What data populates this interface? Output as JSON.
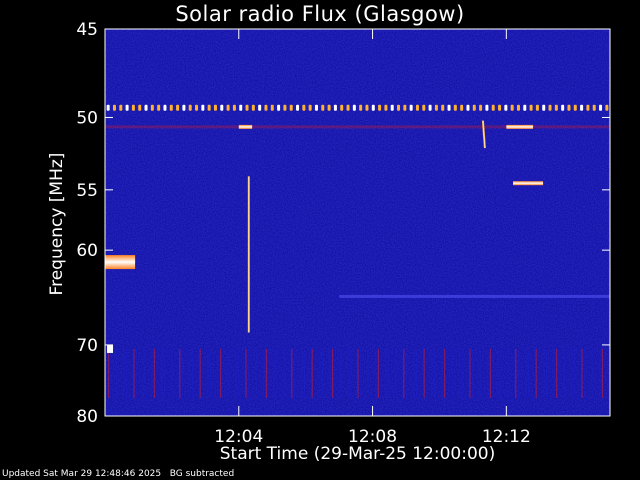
{
  "chart_data": {
    "type": "heatmap",
    "title": "Solar radio Flux (Glasgow)",
    "xlabel": "Start Time (29-Mar-25 12:00:00)",
    "ylabel": "Frequency [MHz]",
    "x_unit": "minutes after 12:00:00",
    "xlim": [
      0,
      15.1
    ],
    "ylim": [
      45,
      80
    ],
    "y_scale": "reciprocal",
    "y_direction": "increasing downward",
    "yticks": [
      45,
      50,
      55,
      60,
      70,
      80
    ],
    "xticks": [
      {
        "value": 4,
        "label": "12:04"
      },
      {
        "value": 8,
        "label": "12:08"
      },
      {
        "value": 12,
        "label": "12:12"
      }
    ],
    "colormap": [
      "#00007a",
      "#2020d0",
      "#d01a2a",
      "#ffb030",
      "#ffffff"
    ],
    "background_color": "#0a0a9a",
    "features": [
      {
        "name": "interference line",
        "freq_mhz": 49.4,
        "t_start": 0,
        "t_end": 15.1,
        "intensity": "high"
      },
      {
        "name": "band",
        "freq_mhz": 50.6,
        "t_start": 0,
        "t_end": 15.1,
        "intensity": "low"
      },
      {
        "name": "burst",
        "freq_mhz": 61.1,
        "t_start": 0,
        "t_end": 0.9,
        "intensity": "high"
      },
      {
        "name": "burst",
        "freq_mhz": 50.6,
        "t_start": 4.0,
        "t_end": 4.4,
        "intensity": "high"
      },
      {
        "name": "burst",
        "freq_mhz": 50.6,
        "t_start": 12.0,
        "t_end": 12.8,
        "intensity": "high"
      },
      {
        "name": "burst",
        "freq_mhz": 54.5,
        "t_start": 12.2,
        "t_end": 13.1,
        "intensity": "high"
      },
      {
        "name": "vertical streak",
        "time_min": 4.3,
        "f_start": 54,
        "f_end": 68.5,
        "intensity": "medium"
      },
      {
        "name": "vertical streak",
        "time_min": 11.3,
        "f_start": 50.2,
        "f_end": 52,
        "intensity": "high"
      },
      {
        "name": "horizontal band",
        "freq_mhz": 64.5,
        "t_start": 7.0,
        "t_end": 15.1,
        "intensity": "low"
      },
      {
        "name": "dot",
        "freq_mhz": 70.5,
        "time_min": 0.15,
        "intensity": "high"
      }
    ]
  },
  "footer": {
    "updated": "Updated Sat Mar 29 12:48:46 2025",
    "note": "BG subtracted"
  }
}
